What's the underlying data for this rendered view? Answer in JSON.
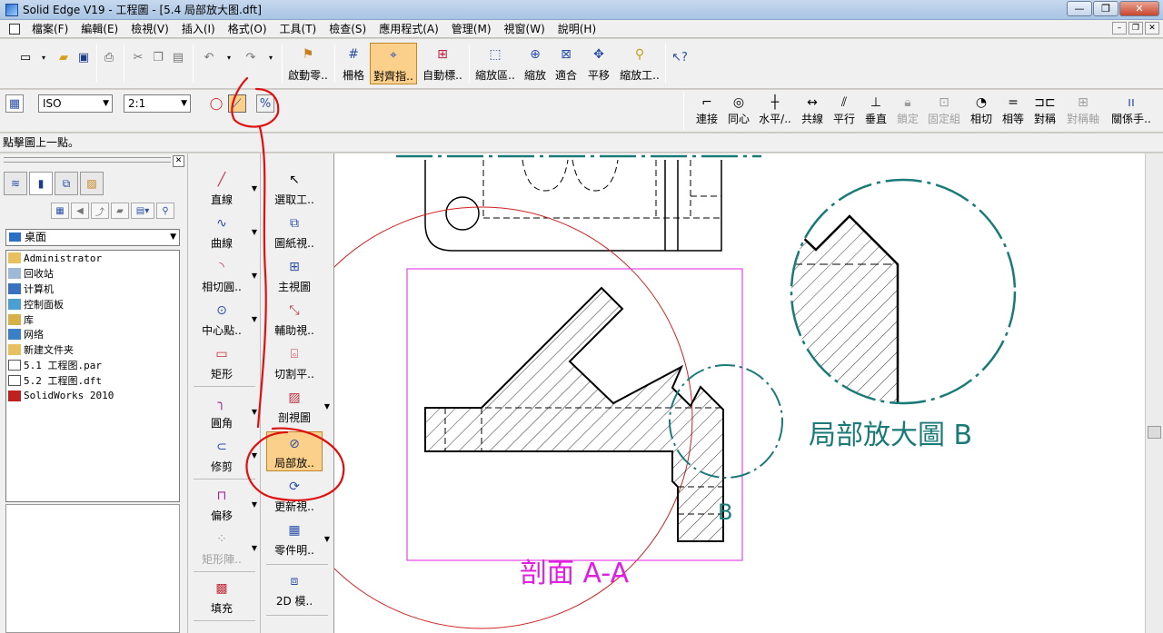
{
  "window": {
    "title": "Solid Edge V19 - 工程圖 - [5.4 局部放大图.dft]"
  },
  "menu": [
    "檔案(F)",
    "編輯(E)",
    "檢視(V)",
    "插入(I)",
    "格式(O)",
    "工具(T)",
    "檢查(S)",
    "應用程式(A)",
    "管理(M)",
    "視窗(W)",
    "說明(H)"
  ],
  "toolbar": {
    "start_part": "啟動零..",
    "grid": "柵格",
    "align": "對齊指..",
    "auto_dim": "自動標..",
    "zoom_area": "縮放區..",
    "zoom": "縮放",
    "fit": "適合",
    "pan": "平移",
    "zoom_tool": "縮放工.."
  },
  "ribbon": {
    "standard": "ISO",
    "scale": "2:1",
    "relations": [
      "連接",
      "同心",
      "水平/..",
      "共線",
      "平行",
      "垂直",
      "鎖定",
      "固定組",
      "相切",
      "相等",
      "對稱",
      "對稱軸",
      "關係手.."
    ]
  },
  "status": "點擊圖上一點。",
  "library": {
    "location": "桌面",
    "items": [
      "Administrator",
      "回收站",
      "计算机",
      "控制面板",
      "库",
      "网络",
      "新建文件夹",
      "5.1 工程图.par",
      "5.2 工程图.dft",
      "SolidWorks 2010"
    ]
  },
  "tools_left": [
    "直線",
    "曲線",
    "相切圓..",
    "中心點..",
    "矩形",
    "圓角",
    "修剪",
    "偏移",
    "矩形陣..",
    "填充"
  ],
  "tools_right": [
    "選取工..",
    "圖紙視..",
    "主視圖",
    "輔助視..",
    "切割平..",
    "剖視圖",
    "局部放..",
    "更新視..",
    "零件明..",
    "2D 模.."
  ],
  "drawing": {
    "section_label": "剖面 A-A",
    "detail_label": "局部放大圖 B",
    "detail_marker": "B"
  },
  "colors": {
    "magenta": "#e020e0",
    "teal": "#1a7a78",
    "red_circle": "#d02020",
    "annotation": "#e01010",
    "active": "#fbd08b"
  }
}
